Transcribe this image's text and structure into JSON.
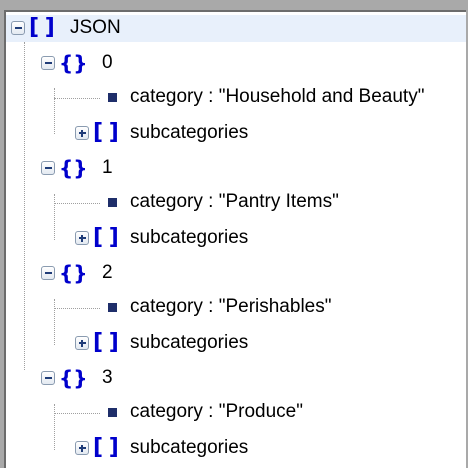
{
  "tree": {
    "root": {
      "label": "JSON",
      "icon": "array-bracket-icon",
      "expanded": true
    },
    "items": [
      {
        "index": "0",
        "property_text": "category : \"Household and Beauty\"",
        "child_label": "subcategories"
      },
      {
        "index": "1",
        "property_text": "category : \"Pantry Items\"",
        "child_label": "subcategories"
      },
      {
        "index": "2",
        "property_text": "category : \"Perishables\"",
        "child_label": "subcategories"
      },
      {
        "index": "3",
        "property_text": "category : \"Produce\"",
        "child_label": "subcategories"
      }
    ]
  },
  "colors": {
    "selection": "#e8f0fb",
    "bracket": "#0000cc",
    "square": "#1f2e6a"
  }
}
